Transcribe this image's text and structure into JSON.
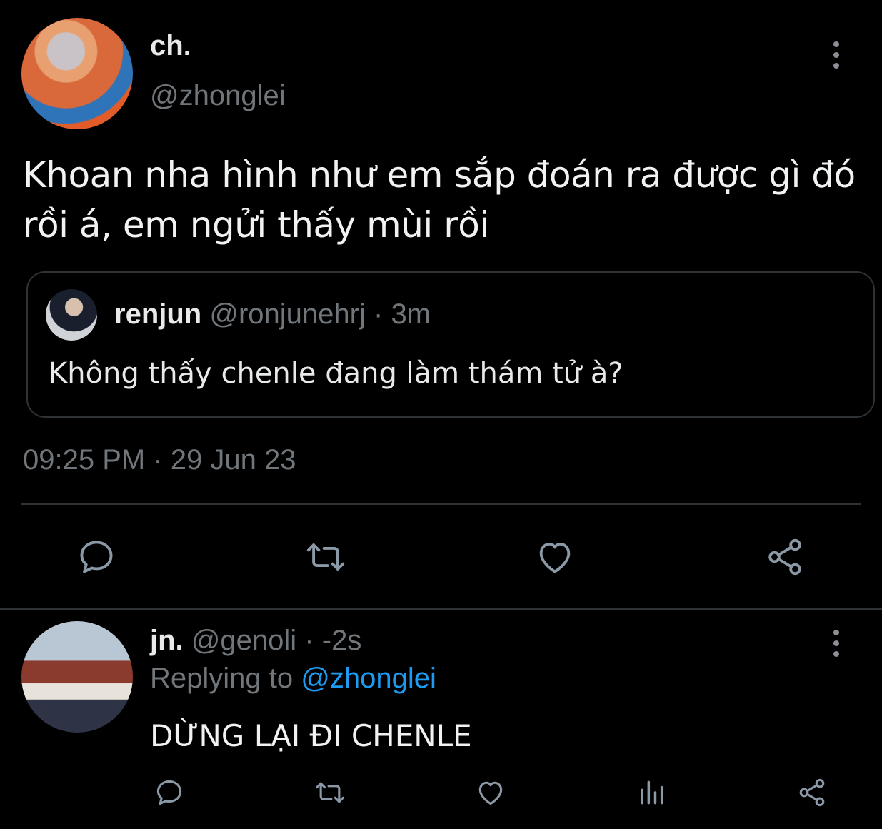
{
  "main_tweet": {
    "display_name": "ch.",
    "handle": "@zhonglei",
    "text": "Khoan nha hình như em sắp đoán ra được gì đó rồi á, em ngửi thấy mùi rồi",
    "quote": {
      "display_name": "renjun",
      "handle": "@ronjunehrj",
      "separator": "·",
      "time": "3m",
      "text": "Không thấy chenle đang làm thám tử à?"
    },
    "timestamp": "09:25 PM · 29 Jun 23",
    "actions": [
      "reply-icon",
      "retweet-icon",
      "like-icon",
      "share-icon"
    ]
  },
  "reply_tweet": {
    "display_name": "jn.",
    "handle": "@genoli",
    "separator": "·",
    "time": "-2s",
    "replying_prefix": "Replying to",
    "replying_to": "@zhonglei",
    "text": "DỪNG LẠI ĐI CHENLE",
    "actions": [
      "reply-icon",
      "retweet-icon",
      "like-icon",
      "analytics-icon",
      "share-icon"
    ]
  },
  "colors": {
    "background": "#000000",
    "primary_text": "#e7e9ea",
    "secondary_text": "#71767b",
    "link": "#1d9bf0",
    "border": "#2f3336",
    "icon": "#8b98a5"
  }
}
